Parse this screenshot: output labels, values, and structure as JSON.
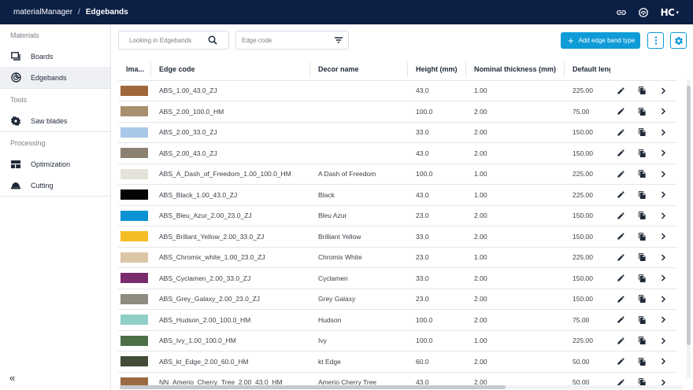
{
  "topbar": {
    "app_name": "materialManager",
    "separator": "/",
    "current_page": "Edgebands",
    "logo_text": "HC",
    "logo_caret": "▾",
    "bg_color": "#0c1f45"
  },
  "sidebar": {
    "sections": [
      {
        "label": "Materials",
        "items": [
          {
            "label": "Boards",
            "icon": "boards-icon"
          },
          {
            "label": "Edgebands",
            "icon": "edgeband-icon",
            "active": true
          }
        ]
      },
      {
        "label": "Tools",
        "items": [
          {
            "label": "Saw blades",
            "icon": "saw-blade-icon"
          }
        ]
      },
      {
        "label": "Processing",
        "items": [
          {
            "label": "Optimization",
            "icon": "optimization-icon"
          },
          {
            "label": "Cutting",
            "icon": "cutting-icon"
          }
        ]
      }
    ],
    "collapse_glyph": "«"
  },
  "toolbar": {
    "search_placeholder": "Looking in Edgebands",
    "filter_placeholder": "Edge code",
    "add_button_label": "Add edge band type",
    "add_plus": "+",
    "accent_color": "#0e9bd8"
  },
  "table": {
    "columns": [
      "Ima...",
      "Edge code",
      "Decor name",
      "Height (mm)",
      "Nominal thickness (mm)",
      "Default lengt"
    ],
    "rows": [
      {
        "color": "#a0673a",
        "edge_code": "ABS_1.00_43.0_ZJ",
        "decor": "",
        "height": "43.0",
        "thickness": "1.00",
        "length": "225.00"
      },
      {
        "color": "#a8906e",
        "edge_code": "ABS_2.00_100.0_HM",
        "decor": "",
        "height": "100.0",
        "thickness": "2.00",
        "length": "75.00"
      },
      {
        "color": "#a9c9ea",
        "edge_code": "ABS_2.00_33.0_ZJ",
        "decor": "",
        "height": "33.0",
        "thickness": "2.00",
        "length": "150.00"
      },
      {
        "color": "#8c8170",
        "edge_code": "ABS_2.00_43.0_ZJ",
        "decor": "",
        "height": "43.0",
        "thickness": "2.00",
        "length": "150.00"
      },
      {
        "color": "#e5e2d8",
        "edge_code": "ABS_A_Dash_of_Freedom_1.00_100.0_HM",
        "decor": "A Dash of Freedom",
        "height": "100.0",
        "thickness": "1.00",
        "length": "225.00"
      },
      {
        "color": "#050505",
        "edge_code": "ABS_Black_1.00_43.0_ZJ",
        "decor": "Black",
        "height": "43.0",
        "thickness": "1.00",
        "length": "225.00"
      },
      {
        "color": "#0a92d4",
        "edge_code": "ABS_Bleu_Azur_2.00_23.0_ZJ",
        "decor": "Bleu Azur",
        "height": "23.0",
        "thickness": "2.00",
        "length": "150.00"
      },
      {
        "color": "#f6bd27",
        "edge_code": "ABS_Brillant_Yellow_2.00_33.0_ZJ",
        "decor": "Brilliant Yellow",
        "height": "33.0",
        "thickness": "2.00",
        "length": "150.00"
      },
      {
        "color": "#dcc6a6",
        "edge_code": "ABS_Chromix_white_1.00_23.0_ZJ",
        "decor": "Chromix White",
        "height": "23.0",
        "thickness": "1.00",
        "length": "225.00"
      },
      {
        "color": "#7a2b6e",
        "edge_code": "ABS_Cyclamen_2.00_33.0_ZJ",
        "decor": "Cyclamen",
        "height": "33.0",
        "thickness": "2.00",
        "length": "150.00"
      },
      {
        "color": "#8e8b81",
        "edge_code": "ABS_Grey_Galaxy_2.00_23.0_ZJ",
        "decor": "Grey Galaxy",
        "height": "23.0",
        "thickness": "2.00",
        "length": "150.00"
      },
      {
        "color": "#8fcfc7",
        "edge_code": "ABS_Hudson_2.00_100.0_HM",
        "decor": "Hudson",
        "height": "100.0",
        "thickness": "2.00",
        "length": "75.00"
      },
      {
        "color": "#4d7049",
        "edge_code": "ABS_Ivy_1.00_100.0_HM",
        "decor": "Ivy",
        "height": "100.0",
        "thickness": "1.00",
        "length": "225.00"
      },
      {
        "color": "#424a38",
        "edge_code": "ABS_kt_Edge_2.00_60.0_HM",
        "decor": "kt Edge",
        "height": "60.0",
        "thickness": "2.00",
        "length": "50.00"
      },
      {
        "color": "#9a6a42",
        "edge_code": "NN_Amerio_Cherry_Tree_2.00_43.0_HM",
        "decor": "Amerio Cherry Tree",
        "height": "43.0",
        "thickness": "2.00",
        "length": "50.00"
      }
    ]
  },
  "icons": {
    "row_actions": [
      "edit-icon",
      "copy-icon",
      "chevron-right-icon"
    ]
  }
}
